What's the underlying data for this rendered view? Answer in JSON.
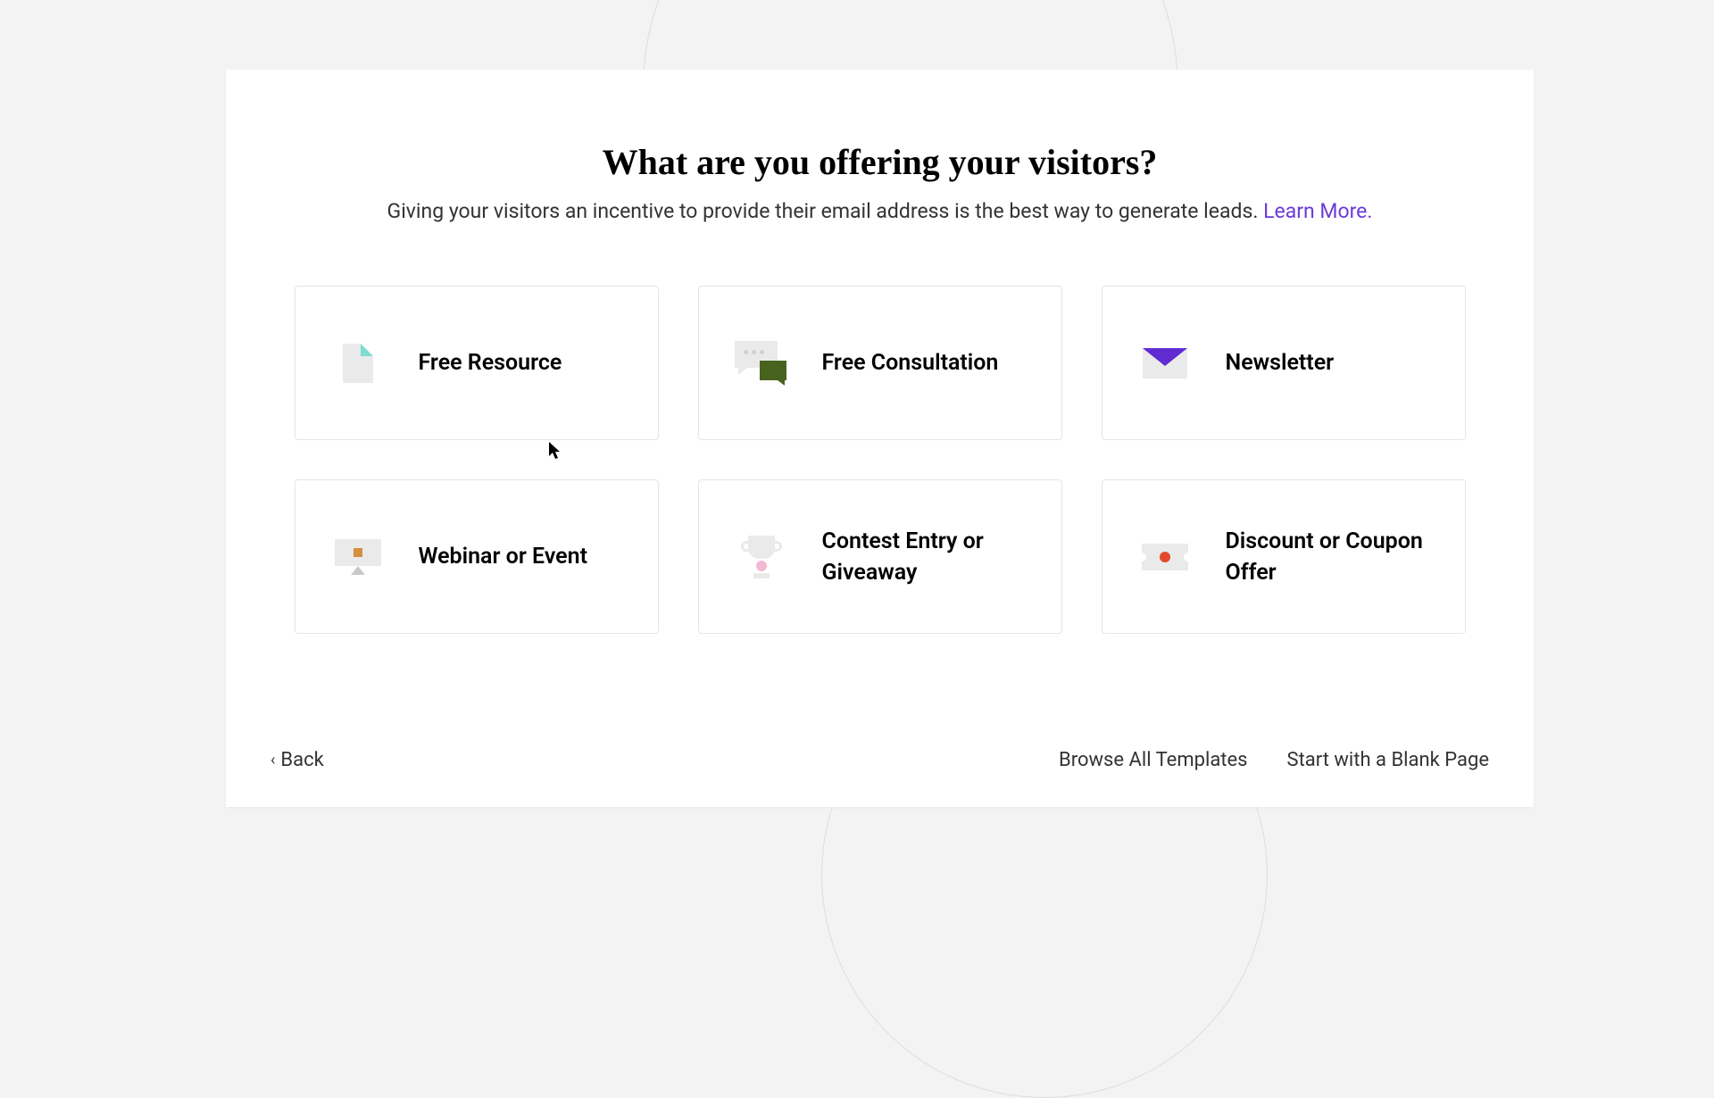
{
  "heading": "What are you offering your visitors?",
  "subheading_text": "Giving your visitors an incentive to provide their email address is the best way to generate leads. ",
  "learn_more": "Learn More.",
  "options": [
    {
      "label": "Free Resource"
    },
    {
      "label": "Free Consultation"
    },
    {
      "label": "Newsletter"
    },
    {
      "label": "Webinar or Event"
    },
    {
      "label": "Contest Entry or Giveaway"
    },
    {
      "label": "Discount or Coupon Offer"
    }
  ],
  "footer": {
    "back": "Back",
    "browse_all": "Browse All Templates",
    "blank_page": "Start with a Blank Page"
  }
}
